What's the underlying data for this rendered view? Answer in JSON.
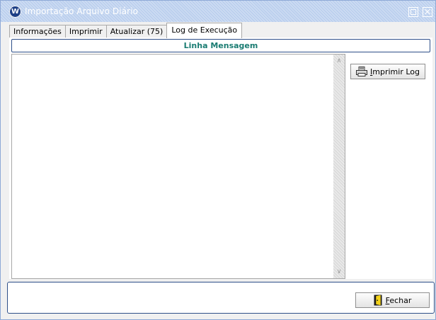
{
  "window": {
    "title": "Importação Arquivo Diário",
    "icon": "vw-logo-icon",
    "icon_text": "W"
  },
  "tabs": [
    {
      "label": "Informações",
      "active": false
    },
    {
      "label": "Imprimir",
      "active": false
    },
    {
      "label": "Atualizar (75)",
      "active": false
    },
    {
      "label": "Log de Execução",
      "active": true
    }
  ],
  "log_panel": {
    "header": "Linha  Mensagem",
    "rows": []
  },
  "print_button": {
    "label_underlined": "I",
    "label_rest": "mprimir Log",
    "icon": "printer-icon"
  },
  "close_button": {
    "label_underlined": "F",
    "label_rest": "echar",
    "icon": "door-exit-icon"
  },
  "colors": {
    "titlebar": "#bcd0ee",
    "header_text": "#1a7c72",
    "frame_border": "#2d4e88"
  }
}
